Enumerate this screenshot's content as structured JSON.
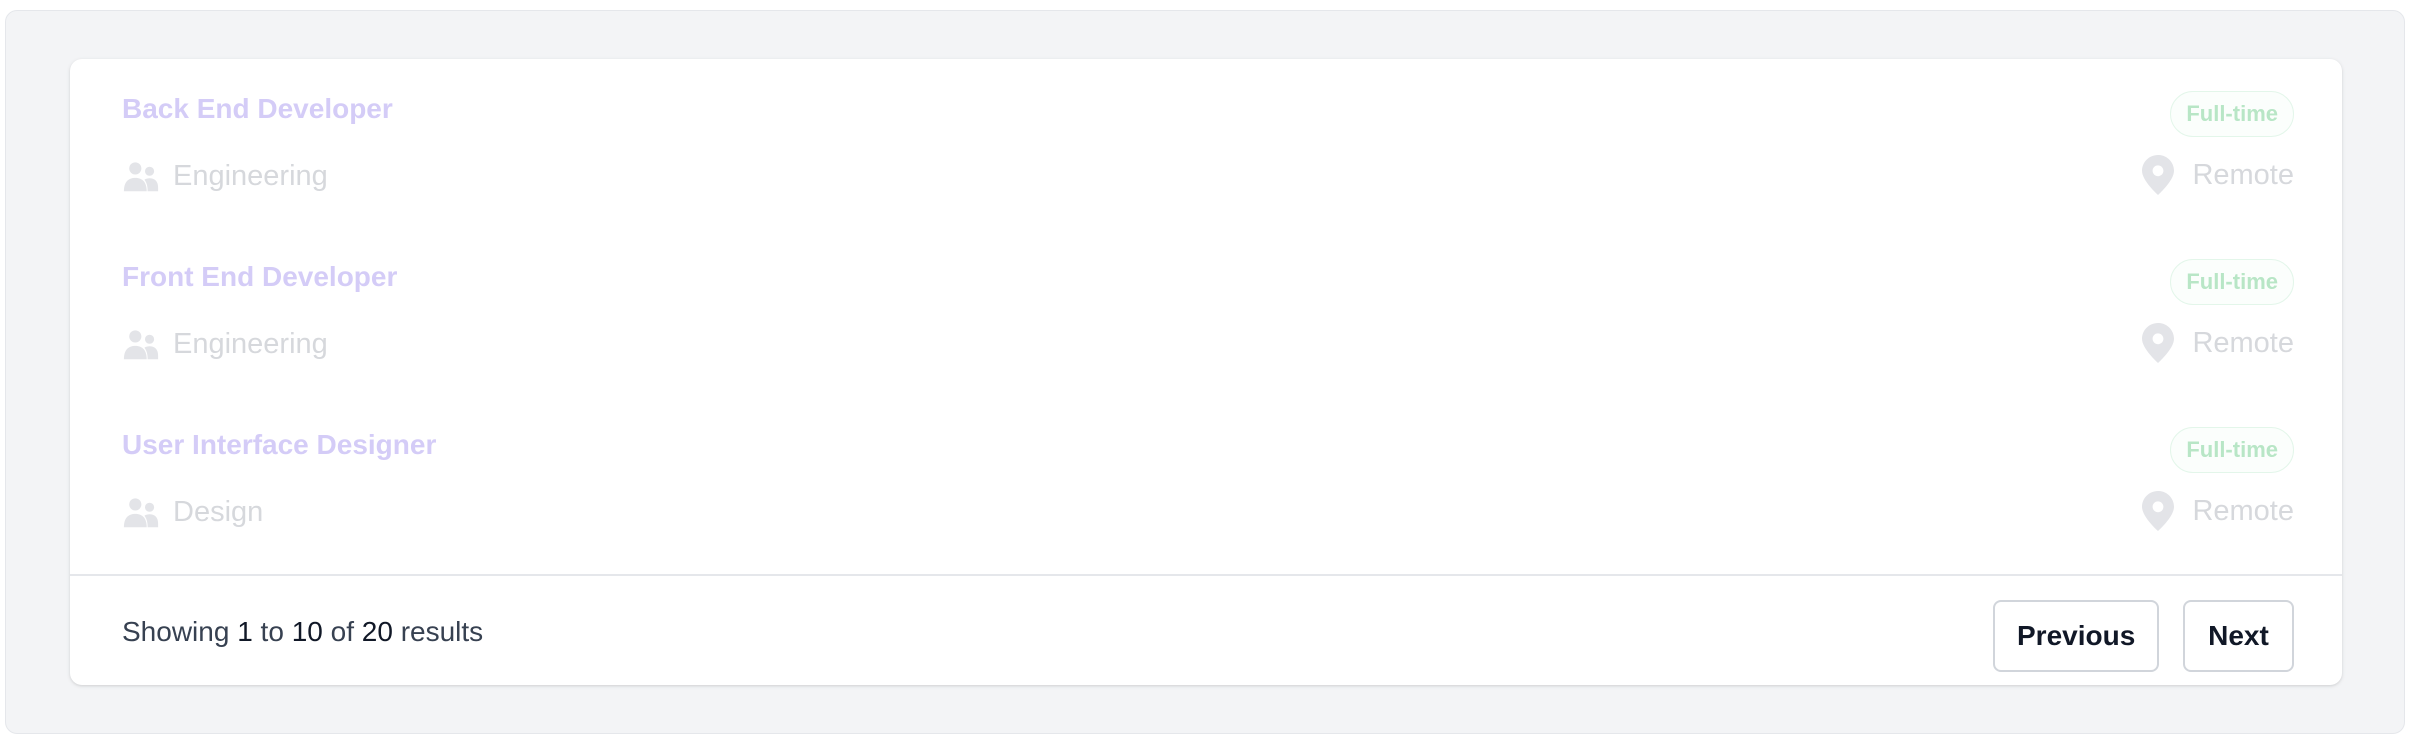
{
  "jobs": [
    {
      "title": "Back End Developer",
      "type": "Full-time",
      "department": "Engineering",
      "location": "Remote"
    },
    {
      "title": "Front End Developer",
      "type": "Full-time",
      "department": "Engineering",
      "location": "Remote"
    },
    {
      "title": "User Interface Designer",
      "type": "Full-time",
      "department": "Design",
      "location": "Remote"
    }
  ],
  "pagination": {
    "showing_prefix": "Showing",
    "from": "1",
    "to_word": "to",
    "to": "10",
    "of_word": "of",
    "total": "20",
    "results_word": "results",
    "previous_label": "Previous",
    "next_label": "Next"
  },
  "icons": {
    "department": "users-icon",
    "location": "location-pin-icon"
  },
  "colors": {
    "title": "#d4ccf7",
    "badge_text": "#b8e6c6",
    "muted_text": "#d6d8dc",
    "icon": "#e3e4e8"
  }
}
